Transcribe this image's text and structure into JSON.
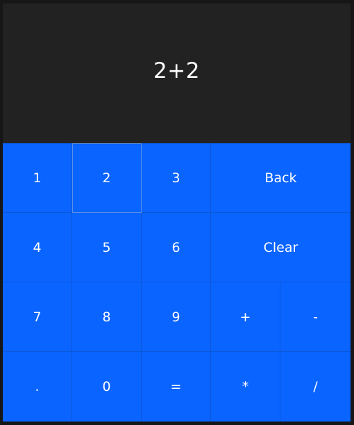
{
  "display": {
    "value": "2+2"
  },
  "keys": {
    "one": "1",
    "two": "2",
    "three": "3",
    "back": "Back",
    "four": "4",
    "five": "5",
    "six": "6",
    "clear": "Clear",
    "seven": "7",
    "eight": "8",
    "nine": "9",
    "plus": "+",
    "minus": "-",
    "dot": ".",
    "zero": "0",
    "equals": "=",
    "multiply": "*",
    "divide": "/"
  },
  "colors": {
    "display_bg": "#222222",
    "key_bg": "#0a64ff",
    "text": "#ffffff"
  }
}
